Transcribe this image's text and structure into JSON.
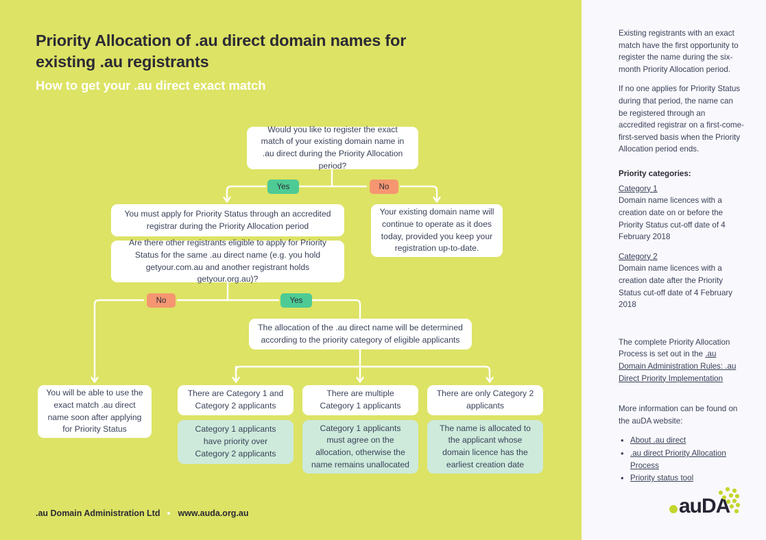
{
  "colors": {
    "lime_background": "#dde364",
    "sidebar_background": "#f9f8fc",
    "box_white": "#ffffff",
    "box_mint": "#cdeadb",
    "chip_yes": "#4ecb95",
    "chip_no": "#f59671",
    "heading_dark": "#2b2a35",
    "body_text": "#3a4259",
    "connector_white": "#ffffff",
    "logo_dark": "#262433",
    "logo_lime": "#c4d62e"
  },
  "header": {
    "title": "Priority Allocation of .au direct domain names for existing .au registrants",
    "subtitle": "How to get your .au direct exact match"
  },
  "flow": {
    "question_root": "Would you like to register the exact match of your existing  domain name in .au direct during the Priority Allocation period?",
    "chip_yes_1": "Yes",
    "chip_no_1": "No",
    "apply_priority_status": "You must apply for Priority Status through an accredited registrar during the Priority Allocation period",
    "continue_operating": "Your existing domain name will continue to operate as it does today, provided you keep your registration up-to-date.",
    "question_other_registrants": "Are there other registrants eligible to apply for Priority Status for the same .au direct name (e.g. you hold getyour.com.au and another registrant holds getyour.org.au)?",
    "chip_no_2": "No",
    "chip_yes_2": "Yes",
    "allocation_determined": "The allocation of the .au direct name will be determined according to the priority category of eligible applicants",
    "outcome_no_other": "You will be able to use the exact match .au direct name soon after applying for Priority Status",
    "case_1_condition": "There are Category 1 and Category 2 applicants",
    "case_1_result": "Category 1 applicants have priority over Category 2 applicants",
    "case_2_condition": "There are multiple Category 1 applicants",
    "case_2_result": "Category 1 applicants must agree on the allocation, otherwise the name remains unallocated",
    "case_3_condition": "There are only Category 2 applicants",
    "case_3_result": "The name is allocated to the applicant whose domain licence has the earliest creation date"
  },
  "footer": {
    "organisation": ".au Domain Administration Ltd",
    "website": "www.auda.org.au"
  },
  "sidebar": {
    "para_1": "Existing registrants with an exact match have the  first opportunity to register the name during the six-month Priority Allocation period.",
    "para_2": "If no one applies for Priority Status during that period, the name can be registered through an accredited registrar on a first-come-first-served basis when the Priority Allocation period ends.",
    "priority_categories_heading": "Priority categories:",
    "category_1_link": "Category 1",
    "category_1_text": "Domain name licences with a creation date on or before the Priority Status cut-off date of 4 February 2018",
    "category_2_link": "Category 2",
    "category_2_text": "Domain name licences with a creation date after the Priority Status cut-off date of 4 February 2018",
    "complete_process_prefix": "The complete Priority Allocation Process is set out in the ",
    "complete_process_link": ".au Domain Administration Rules: .au Direct Priority Implementation",
    "more_info_intro": "More information can be found on the auDA website:",
    "links": [
      "About .au direct",
      ".au direct Priority Allocation Process",
      "Priority status tool"
    ]
  },
  "logo": {
    "wordmark": ".auDA"
  }
}
